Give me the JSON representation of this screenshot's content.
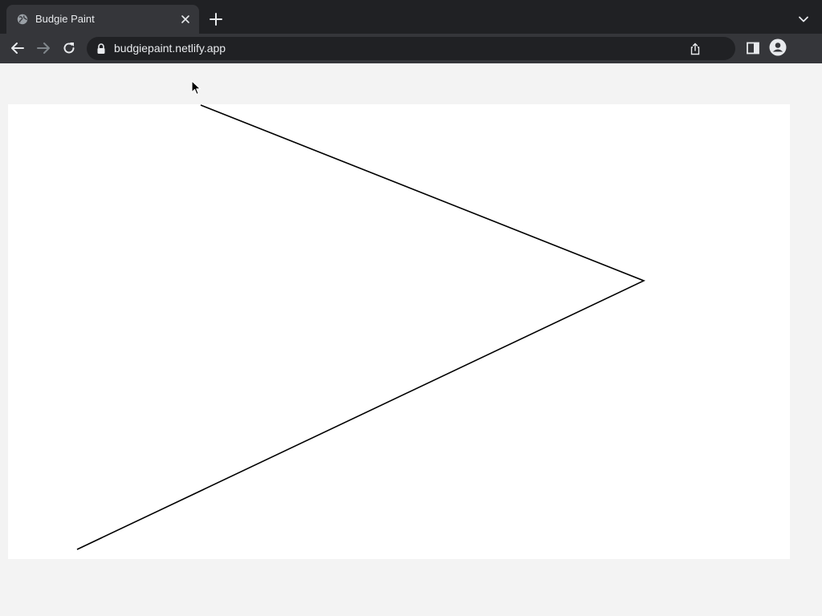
{
  "browser": {
    "tab": {
      "title": "Budgie Paint",
      "favicon": "globe-icon",
      "close_icon": "close-icon"
    },
    "new_tab_icon": "plus-icon",
    "tab_search_icon": "chevron-down-icon",
    "toolbar": {
      "back_icon": "arrow-left-icon",
      "forward_icon": "arrow-right-icon",
      "reload_icon": "reload-icon",
      "lock_icon": "lock-icon",
      "url": "budgiepaint.netlify.app",
      "share_icon": "share-icon",
      "side_panel_icon": "side-panel-icon",
      "profile_icon": "profile-icon"
    }
  },
  "colors": {
    "tabstrip": "#202124",
    "toolbar": "#35363a",
    "page_background": "#f3f3f3",
    "canvas_background": "#ffffff",
    "stroke": "#000000"
  }
}
